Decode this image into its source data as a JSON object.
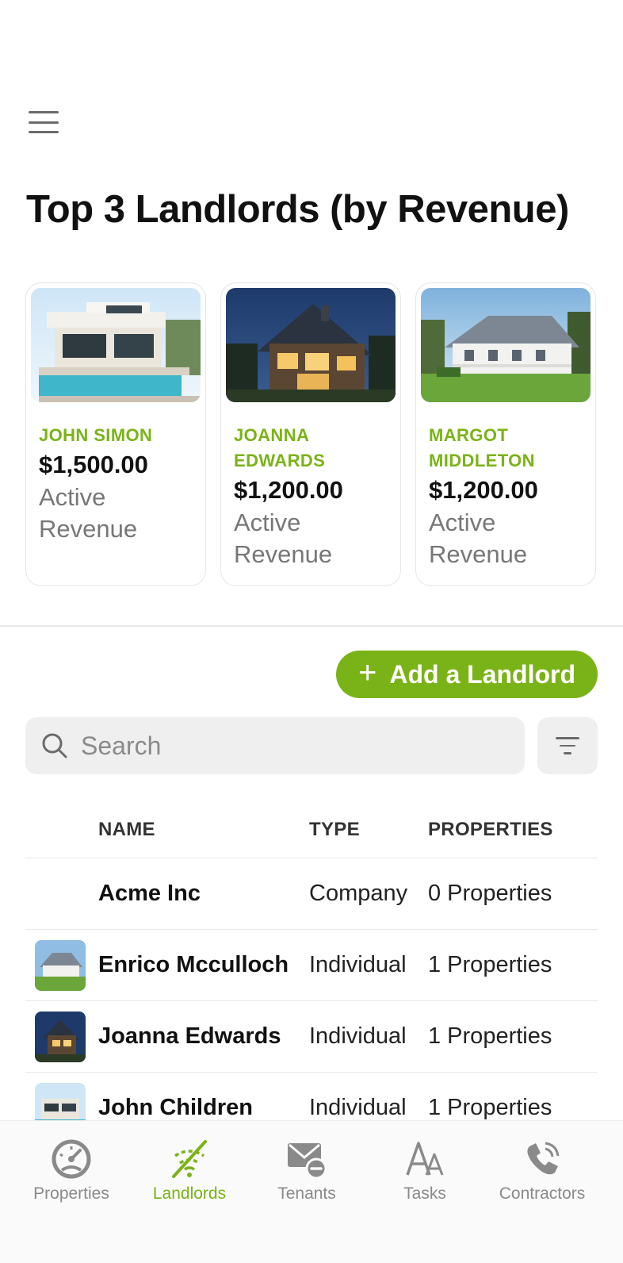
{
  "header": {
    "menu_icon": "hamburger-menu-icon"
  },
  "page_title": "Top 3 Landlords (by Revenue)",
  "top_landlords": [
    {
      "name": "JOHN SIMON",
      "amount": "$1,500.00",
      "label": "Active Revenue",
      "image": "modern-villa-pool"
    },
    {
      "name": "JOANNA EDWARDS",
      "amount": "$1,200.00",
      "label": "Active Revenue",
      "image": "house-at-dusk"
    },
    {
      "name": "MARGOT MIDDLETON",
      "amount": "$1,200.00",
      "label": "Active Revenue",
      "image": "white-farmhouse"
    }
  ],
  "actions": {
    "add_landlord": "Add a Landlord",
    "add_icon": "plus-icon"
  },
  "search": {
    "placeholder": "Search",
    "value": "",
    "icon": "search-icon",
    "filter_icon": "filter-icon"
  },
  "table": {
    "headers": {
      "name": "NAME",
      "type": "TYPE",
      "properties": "PROPERTIES"
    },
    "rows": [
      {
        "name": "Acme Inc",
        "type": "Company",
        "properties": "0 Properties",
        "thumb": ""
      },
      {
        "name": "Enrico Mcculloch",
        "type": "Individual",
        "properties": "1 Properties",
        "thumb": "white-farmhouse"
      },
      {
        "name": "Joanna Edwards",
        "type": "Individual",
        "properties": "1 Properties",
        "thumb": "house-at-dusk"
      },
      {
        "name": "John Children",
        "type": "Individual",
        "properties": "1 Properties",
        "thumb": "modern-villa-pool"
      }
    ]
  },
  "tabbar": {
    "active": "Landlords",
    "items": [
      {
        "label": "Properties",
        "icon": "speedometer-icon"
      },
      {
        "label": "Landlords",
        "icon": "wifi-signal-icon"
      },
      {
        "label": "Tenants",
        "icon": "mail-minus-icon"
      },
      {
        "label": "Tasks",
        "icon": "text-font-icon"
      },
      {
        "label": "Contractors",
        "icon": "phone-call-icon"
      }
    ]
  },
  "colors": {
    "accent": "#7ab317",
    "muted": "#8a8a8a",
    "field_bg": "#efefef",
    "divider": "#e8e8e8"
  }
}
